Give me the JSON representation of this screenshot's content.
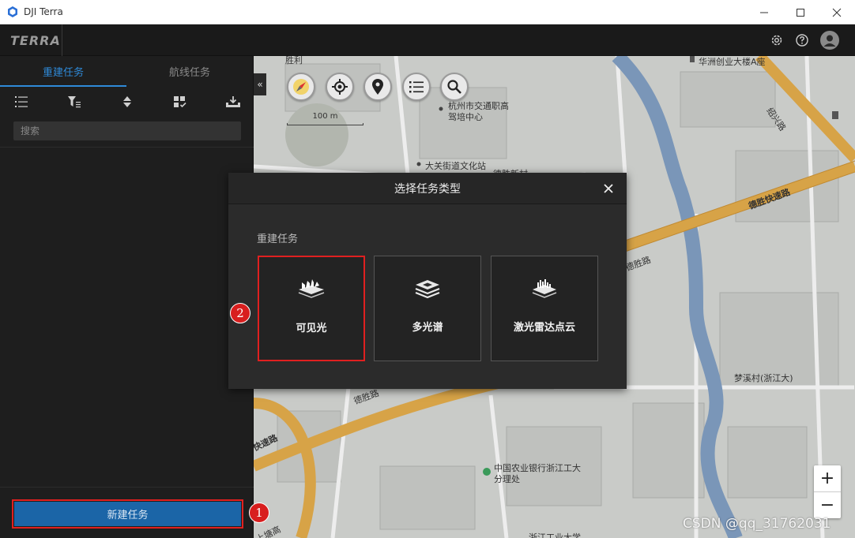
{
  "window": {
    "title": "DJI Terra"
  },
  "header": {
    "logo": "TERRA",
    "icons": [
      "gear-icon",
      "help-icon",
      "user-avatar-icon"
    ]
  },
  "sidebar": {
    "tabs": [
      {
        "label": "重建任务",
        "active": true
      },
      {
        "label": "航线任务",
        "active": false
      }
    ],
    "toolbar_icons": [
      "list-icon",
      "filter-icon",
      "sort-icon",
      "batch-select-icon",
      "import-icon"
    ],
    "search_placeholder": "搜索",
    "new_task_label": "新建任务"
  },
  "annotations": {
    "step1": "1",
    "step2": "2"
  },
  "map": {
    "scale_label": "100 m",
    "controls": [
      "compass-icon",
      "locate-icon",
      "pin-icon",
      "list-icon",
      "search-icon"
    ],
    "labels": {
      "l1": "胜利",
      "l2": "华洲创业大楼A座",
      "l3": "杭州市交通职高",
      "l4": "驾培中心",
      "l5": "大关街道文化站",
      "l6": "德胜新村",
      "l7": "绍兴路",
      "l8": "德胜快速路",
      "l9": "德胜路",
      "l10": "德胜路",
      "l11": "快速路",
      "l12": "梦溪村(浙江大)",
      "l13": "中国农业银行浙江工大",
      "l14": "分理处",
      "l15": "上塘高",
      "l16": "浙江工业大学"
    },
    "zoom_in": "+",
    "zoom_out": "−",
    "watermark": "CSDN @qq_31762031"
  },
  "dialog": {
    "title": "选择任务类型",
    "section": "重建任务",
    "options": [
      {
        "label": "可见光",
        "icon": "visible-light-icon",
        "highlighted": true
      },
      {
        "label": "多光谱",
        "icon": "multispectral-icon",
        "highlighted": false
      },
      {
        "label": "激光雷达点云",
        "icon": "lidar-pointcloud-icon",
        "highlighted": false
      }
    ]
  },
  "colors": {
    "accent": "#2f8ad8",
    "button": "#1b65a7",
    "annotation_red": "#e02020",
    "road_orange": "#d7a347"
  }
}
